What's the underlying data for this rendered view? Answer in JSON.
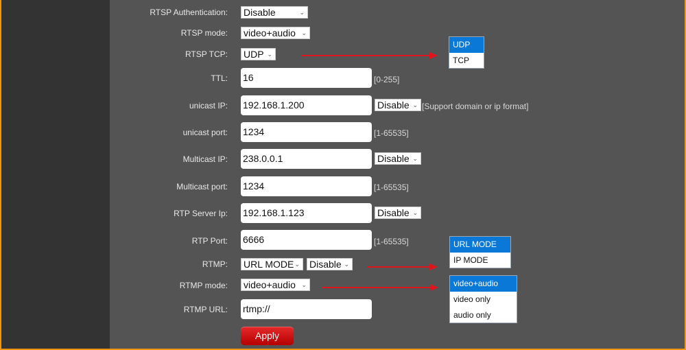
{
  "form": {
    "rtsp_auth": {
      "label": "RTSP Authentication:",
      "value": "Disable"
    },
    "rtsp_mode": {
      "label": "RTSP mode:",
      "value": "video+audio"
    },
    "rtsp_tcp": {
      "label": "RTSP TCP:",
      "value": "UDP"
    },
    "ttl": {
      "label": "TTL:",
      "value": "16",
      "hint": "[0-255]"
    },
    "unicast_ip": {
      "label": "unicast IP:",
      "value": "192.168.1.200",
      "select": "Disable",
      "hint": "[Support domain or ip format]"
    },
    "unicast_port": {
      "label": "unicast port:",
      "value": "1234",
      "hint": "[1-65535]"
    },
    "multicast_ip": {
      "label": "Multicast IP:",
      "value": "238.0.0.1",
      "select": "Disable"
    },
    "multicast_port": {
      "label": "Multicast port:",
      "value": "1234",
      "hint": "[1-65535]"
    },
    "rtp_server_ip": {
      "label": "RTP Server Ip:",
      "value": "192.168.1.123",
      "select": "Disable"
    },
    "rtp_port": {
      "label": "RTP Port:",
      "value": "6666",
      "hint": "[1-65535]"
    },
    "rtmp": {
      "label": "RTMP:",
      "mode": "URL MODE",
      "select": "Disable"
    },
    "rtmp_mode": {
      "label": "RTMP mode:",
      "value": "video+audio"
    },
    "rtmp_url": {
      "label": "RTMP URL:",
      "value": "rtmp://"
    },
    "apply_label": "Apply"
  },
  "dropdowns": {
    "rtsp_tcp_options": [
      "UDP",
      "TCP"
    ],
    "rtmp_mode_options": [
      "URL MODE",
      "IP MODE"
    ],
    "rtmp_stream_options": [
      "video+audio",
      "video only",
      "audio only"
    ]
  },
  "colors": {
    "frame": "#f0960f",
    "accent": "#0a78d7",
    "arrow": "#e0141c",
    "apply": "#d01010"
  }
}
